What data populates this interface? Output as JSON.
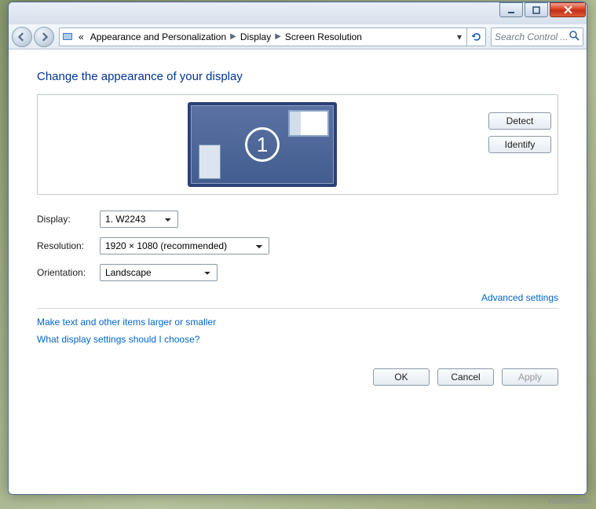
{
  "window": {
    "min_label": "minimize",
    "max_label": "maximize",
    "close_label": "close"
  },
  "breadcrumb": {
    "prefix": "«",
    "items": [
      "Appearance and Personalization",
      "Display",
      "Screen Resolution"
    ]
  },
  "search": {
    "placeholder": "Search Control ..."
  },
  "header": {
    "title": "Change the appearance of your display"
  },
  "preview": {
    "monitor_number": "1",
    "detect_label": "Detect",
    "identify_label": "Identify"
  },
  "fields": {
    "display": {
      "label": "Display:",
      "hotkey": "D",
      "value": "1. W2243"
    },
    "resolution": {
      "label": "Resolution:",
      "hotkey": "R",
      "value": "1920 × 1080 (recommended)"
    },
    "orientation": {
      "label": "Orientation:",
      "hotkey": "O",
      "value": "Landscape"
    }
  },
  "links": {
    "advanced": "Advanced settings",
    "textsize": "Make text and other items larger or smaller",
    "help": "What display settings should I choose?"
  },
  "buttons": {
    "ok": "OK",
    "cancel": "Cancel",
    "apply": "Apply"
  },
  "watermark": "wsxdn.com"
}
